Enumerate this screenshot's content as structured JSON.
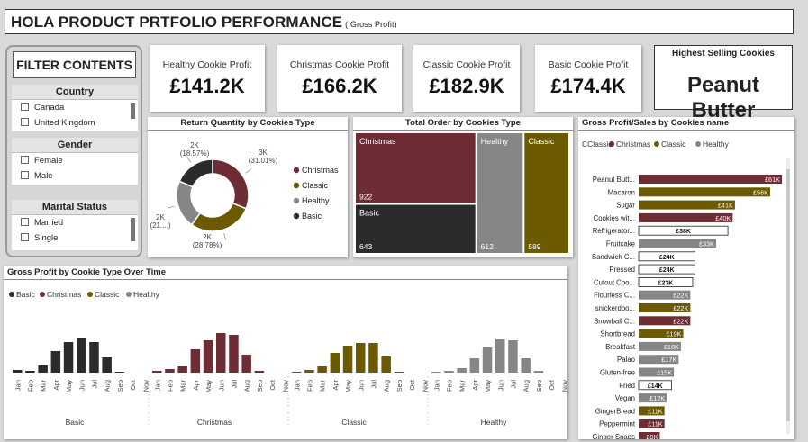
{
  "header": {
    "title": "HOLA PRODUCT PRTFOLIO PERFORMANCE",
    "subtitle": "( Gross Profit)"
  },
  "filters": {
    "title": "FILTER CONTENTS",
    "country": {
      "label": "Country",
      "options": [
        "Canada",
        "United Kingdom"
      ]
    },
    "gender": {
      "label": "Gender",
      "options": [
        "Female",
        "Male"
      ]
    },
    "marital": {
      "label": "Marital Status",
      "options": [
        "Married",
        "Single"
      ]
    }
  },
  "kpis": [
    {
      "label": "Healthy Cookie Profit",
      "value": "£141.2K"
    },
    {
      "label": "Christmas Cookie Profit",
      "value": "£166.2K"
    },
    {
      "label": "Classic Cookie Profit",
      "value": "£182.9K"
    },
    {
      "label": "Basic Cookie Profit",
      "value": "£174.4K"
    }
  ],
  "top_seller": {
    "label": "Highest Selling Cookies",
    "value": "Peanut Butter"
  },
  "colors": {
    "Basic": "#2b2b2b",
    "Christmas": "#6e2d35",
    "Classic": "#6b5a00",
    "Healthy": "#868686"
  },
  "chart_data": [
    {
      "type": "pie",
      "title": "Return Quantity by Cookies Type",
      "legend": [
        "Christmas",
        "Classic",
        "Healthy",
        "Basic"
      ],
      "slices": [
        {
          "name": "Christmas",
          "value": 3000,
          "value_label": "3K",
          "percent_label": "(31.01%)"
        },
        {
          "name": "Classic",
          "value": 2000,
          "value_label": "2K",
          "percent_label": "(28.78%)"
        },
        {
          "name": "Healthy",
          "value": 2000,
          "value_label": "2K",
          "percent_label": "(21....)"
        },
        {
          "name": "Basic",
          "value": 2000,
          "value_label": "2K",
          "percent_label": "(18.57%)"
        }
      ],
      "percents": [
        31.01,
        28.78,
        21.64,
        18.57
      ]
    },
    {
      "type": "treemap",
      "title": "Total Order by Cookies Type",
      "items": [
        {
          "name": "Christmas",
          "value": 922
        },
        {
          "name": "Basic",
          "value": 643
        },
        {
          "name": "Healthy",
          "value": 612
        },
        {
          "name": "Classic",
          "value": 589
        }
      ]
    },
    {
      "type": "bar",
      "orientation": "horizontal",
      "title": "Gross Profit/Sales by Cookies name",
      "legend": [
        "Classic",
        "Christmas",
        "Classic",
        "Healthy"
      ],
      "legend_prefix": "C",
      "categories": [
        "Peanut Butt...",
        "Macaron",
        "Sugar",
        "Cookies wit...",
        "Refrigerator...",
        "Fruitcake",
        "Sandwich C...",
        "Pressed",
        "Cutout Coo...",
        "Flourless C...",
        "snickerdoo...",
        "Snowball C...",
        "Shortbread",
        "Breakfast",
        "Palao",
        "Gluten-free",
        "Fried",
        "Vegan",
        "GingerBread",
        "Peppermint",
        "Ginger Snaps"
      ],
      "values": [
        61,
        56,
        41,
        40,
        38,
        33,
        24,
        24,
        23,
        22,
        22,
        22,
        19,
        18,
        17,
        15,
        14,
        12,
        11,
        11,
        9
      ],
      "labels": [
        "£61K",
        "£56K",
        "£41K",
        "£40K",
        "£38K",
        "£33K",
        "£24K",
        "£24K",
        "£23K",
        "£22K",
        "£22K",
        "£22K",
        "£19K",
        "£18K",
        "£17K",
        "£15K",
        "£14K",
        "£12K",
        "£11K",
        "£11K",
        "£9K"
      ],
      "series_of": [
        "Christmas",
        "Classic",
        "Classic",
        "Christmas",
        "Pattern",
        "Healthy",
        "Pattern",
        "Pattern",
        "Pattern",
        "Healthy",
        "Classic",
        "Christmas",
        "Classic",
        "Healthy",
        "Healthy",
        "Healthy",
        "Pattern",
        "Healthy",
        "Classic",
        "Christmas",
        "Christmas"
      ],
      "xlim": [
        0,
        70
      ]
    },
    {
      "type": "bar",
      "title": "Gross Profit by Cookie Type Over Time",
      "legend": [
        "Basic",
        "Christmas",
        "Classic",
        "Healthy"
      ],
      "months": [
        "Jan",
        "Feb",
        "Mar",
        "Apr",
        "May",
        "Jun",
        "Jul",
        "Aug",
        "Sep",
        "Oct",
        "Nov"
      ],
      "series": [
        {
          "name": "Basic",
          "values": [
            3,
            2,
            8,
            24,
            34,
            38,
            34,
            17,
            1,
            0,
            0
          ]
        },
        {
          "name": "Christmas",
          "values": [
            2,
            4,
            7,
            26,
            36,
            44,
            42,
            20,
            2,
            0,
            0
          ]
        },
        {
          "name": "Classic",
          "values": [
            1,
            3,
            7,
            22,
            30,
            33,
            33,
            18,
            1,
            0,
            0
          ]
        },
        {
          "name": "Healthy",
          "values": [
            1,
            2,
            5,
            16,
            28,
            37,
            36,
            16,
            2,
            0,
            0
          ]
        }
      ],
      "ylim": [
        0,
        55
      ]
    }
  ]
}
